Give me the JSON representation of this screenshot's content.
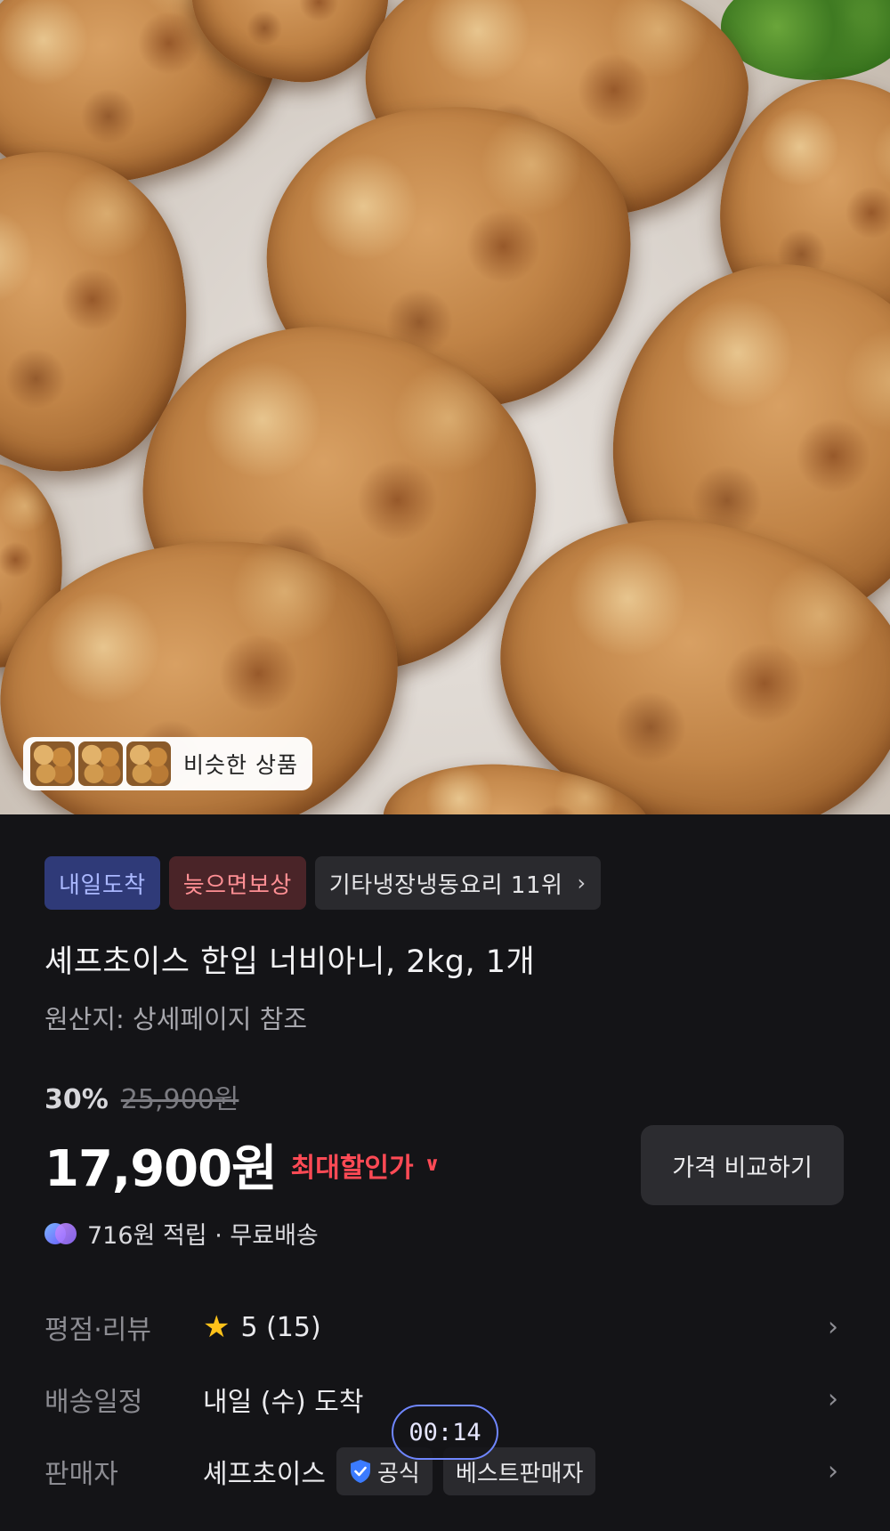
{
  "hero": {
    "similar_label": "비슷한 상품"
  },
  "badges": {
    "arrival": "내일도착",
    "late_comp": "늦으면보상",
    "rank": "기타냉장냉동요리 11위"
  },
  "product": {
    "title": "셰프초이스 한입 너비아니, 2kg, 1개",
    "origin": "원산지: 상세페이지 참조"
  },
  "pricing": {
    "discount_pct": "30%",
    "original_price": "25,900원",
    "price": "17,900원",
    "max_discount_label": "최대할인가",
    "compare_button": "가격 비교하기",
    "points_text": "716원 적립 · 무료배송"
  },
  "info": {
    "rating_label": "평점·리뷰",
    "rating_value": "5 (15)",
    "delivery_label": "배송일정",
    "delivery_value": "내일 (수) 도착",
    "seller_label": "판매자",
    "seller_name": "셰프초이스",
    "official_badge": "공식",
    "best_seller_badge": "베스트판매자"
  },
  "overlay": {
    "timer": "00:14"
  },
  "colors": {
    "background": "#141417",
    "accent_red": "#ff4a55",
    "star": "#ffc21a",
    "badge_blue_bg": "#2f3a78",
    "badge_red_bg": "#4a2428"
  }
}
